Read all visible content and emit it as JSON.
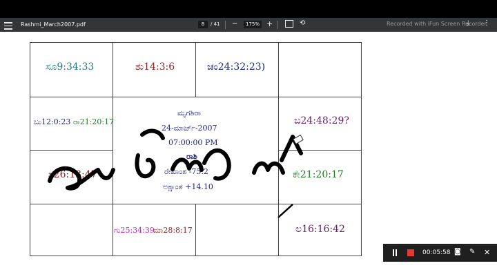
{
  "toolbar": {
    "file_name": "Rashmi_March2007.pdf",
    "page_current": "8",
    "page_total": "/ 41",
    "zoom": "175%",
    "watermark": "Recorded with iFun Screen Recorder"
  },
  "chart_cells": {
    "c1": "ಸೂ9:34:33",
    "c2": "ಶು14:3:6",
    "c3": "ಚಂ24:32:23)",
    "c4": "ಬು12:0:23",
    "c5": "ರಾ21:20:17",
    "c6": "ಬ24:48:29?",
    "c7": "ಶ26:13:47",
    "c8": "ಕೇ21:20:17",
    "c9": "ಗು25:34:39",
    "c10": "ಮಾ28:8:17",
    "c11": "ಲ16:16:42"
  },
  "center": {
    "nakshatra": "ಮೃಗಶಿರಾ",
    "date": "24-ಮಾರ್ಚ್-2007",
    "time": "07:00:00 PM",
    "rashi": "ರಾಶಿ",
    "longitude": "ರೇಖಾಂಶ   -75.2",
    "latitude": "ಅಕ್ಷಾಂಶ   +14.10"
  },
  "recorder": {
    "elapsed": "00:05:58"
  },
  "colors": {
    "toolbar_bg": "#323639",
    "teal": "#1b7a7a",
    "maroon": "#8b2020",
    "navy": "#1a237e",
    "green": "#1b7a1b",
    "purple": "#6a1b6a",
    "magenta": "#c020c0"
  }
}
